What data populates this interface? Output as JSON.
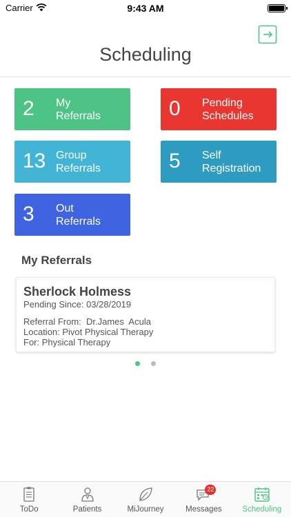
{
  "status_bar": {
    "carrier": "Carrier",
    "time": "9:43 AM"
  },
  "header": {
    "title": "Scheduling"
  },
  "tiles": [
    {
      "count": "2",
      "line1": "My",
      "line2": "Referrals",
      "color": "#4dc485"
    },
    {
      "count": "0",
      "line1": "Pending",
      "line2": "Schedules",
      "color": "#ea3631"
    },
    {
      "count": "13",
      "line1": "Group",
      "line2": "Referrals",
      "color": "#42b5d6"
    },
    {
      "count": "5",
      "line1": "Self",
      "line2": "Registration",
      "color": "#2e9cc1"
    },
    {
      "count": "3",
      "line1": "Out",
      "line2": "Referrals",
      "color": "#3f64e2"
    }
  ],
  "section": {
    "title": "My Referrals"
  },
  "referral": {
    "name": "Sherlock Holmess",
    "pending": "Pending Since: 03/28/2019",
    "from": "Referral From:  Dr.James  Acula",
    "location": "Location: Pivot Physical Therapy",
    "for": "For: Physical Therapy"
  },
  "pager": {
    "active_color": "#4dc485",
    "inactive_color": "#bbbbbb"
  },
  "tabs": [
    {
      "label": "ToDo",
      "icon": "todo-icon"
    },
    {
      "label": "Patients",
      "icon": "patients-icon"
    },
    {
      "label": "MiJourney",
      "icon": "leaf-icon"
    },
    {
      "label": "Messages",
      "icon": "messages-icon",
      "badge": "22"
    },
    {
      "label": "Scheduling",
      "icon": "calendar-icon",
      "active": true
    }
  ],
  "colors": {
    "accent": "#4dc485",
    "badge": "#e82d2d"
  }
}
